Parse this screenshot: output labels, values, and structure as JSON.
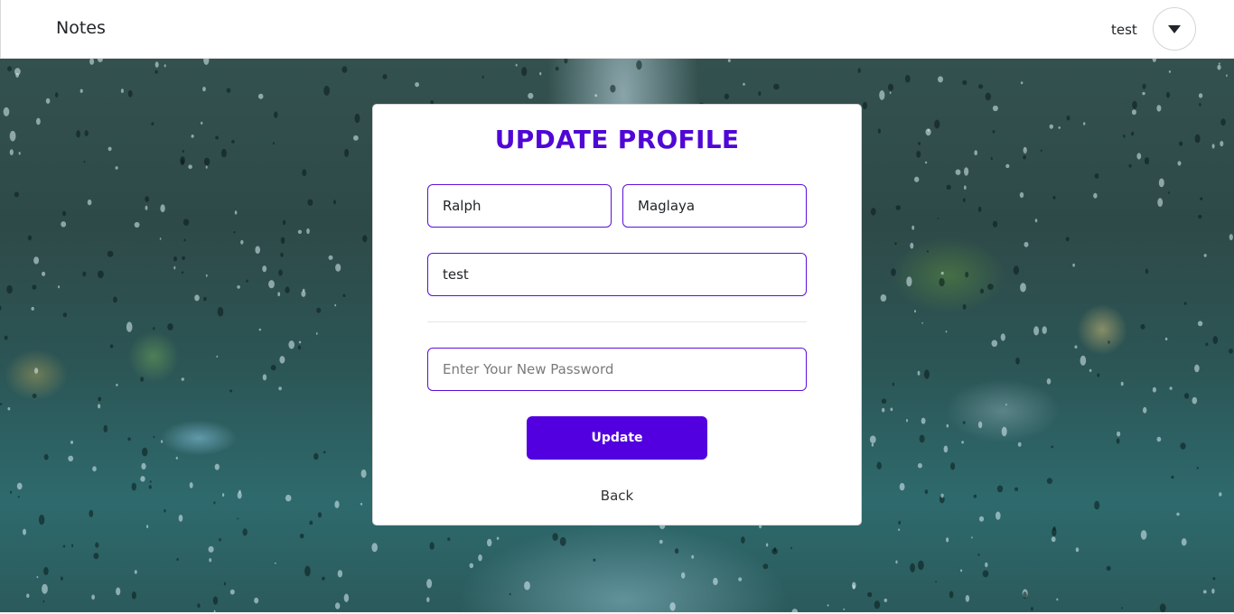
{
  "navbar": {
    "brand": "Notes",
    "username": "test",
    "dropdown_icon": "caret-down-icon"
  },
  "form": {
    "title": "UPDATE PROFILE",
    "first_name": {
      "value": "Ralph"
    },
    "last_name": {
      "value": "Maglaya"
    },
    "username": {
      "value": "test"
    },
    "password": {
      "value": "",
      "placeholder": "Enter Your New Password"
    },
    "submit_label": "Update",
    "back_label": "Back"
  },
  "colors": {
    "accent": "#5200e0",
    "title": "#5007d6",
    "field_border": "#5a0fd9"
  }
}
